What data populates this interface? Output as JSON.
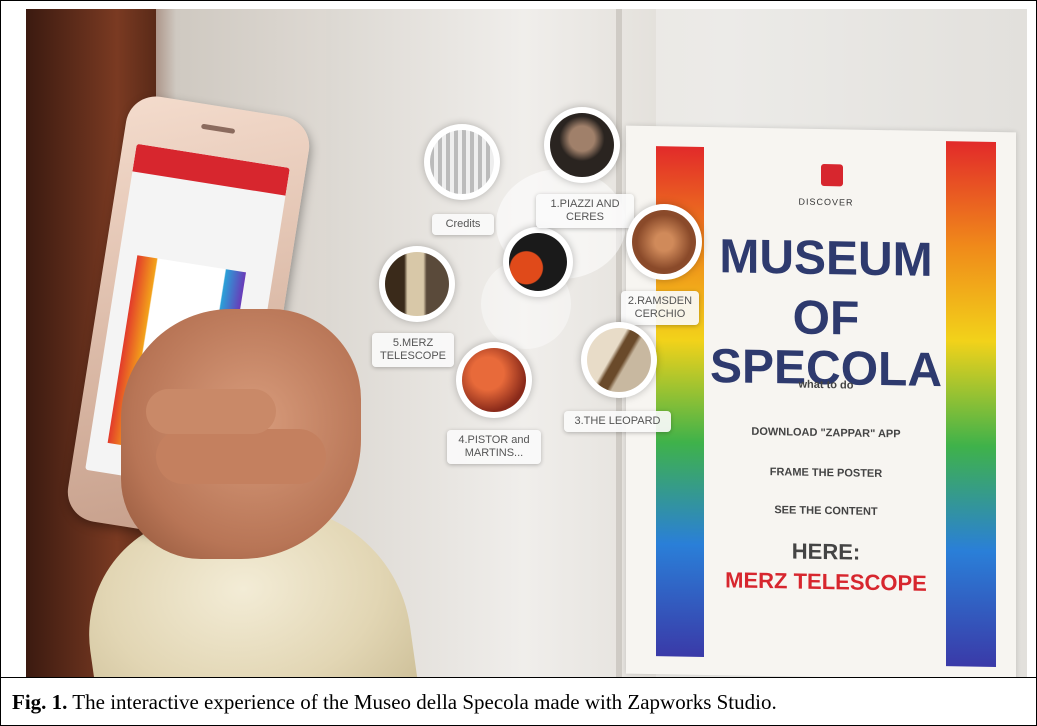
{
  "caption": {
    "label": "Fig. 1.",
    "text": " The interactive experience of the Museo della Specola made with Zapworks Studio."
  },
  "ar_overlay": {
    "items": [
      {
        "label": "Credits"
      },
      {
        "label": "1.PIAZZI AND\nCERES"
      },
      {
        "label": "2.RAMSDEN\nCERCHIO"
      },
      {
        "label": "3.THE LEOPARD"
      },
      {
        "label": "4.PISTOR and\nMARTINS..."
      },
      {
        "label": "5.MERZ\nTELESCOPE"
      }
    ]
  },
  "poster": {
    "discover": "DISCOVER",
    "title_line1": "MUSEUM",
    "title_line2": "OF SPECOLA",
    "what_to_do": "what to do",
    "step1": "DOWNLOAD \"ZAPPAR\" APP",
    "step2": "FRAME THE POSTER",
    "step3": "SEE THE CONTENT",
    "here": "HERE:",
    "target": "MERZ TELESCOPE"
  }
}
